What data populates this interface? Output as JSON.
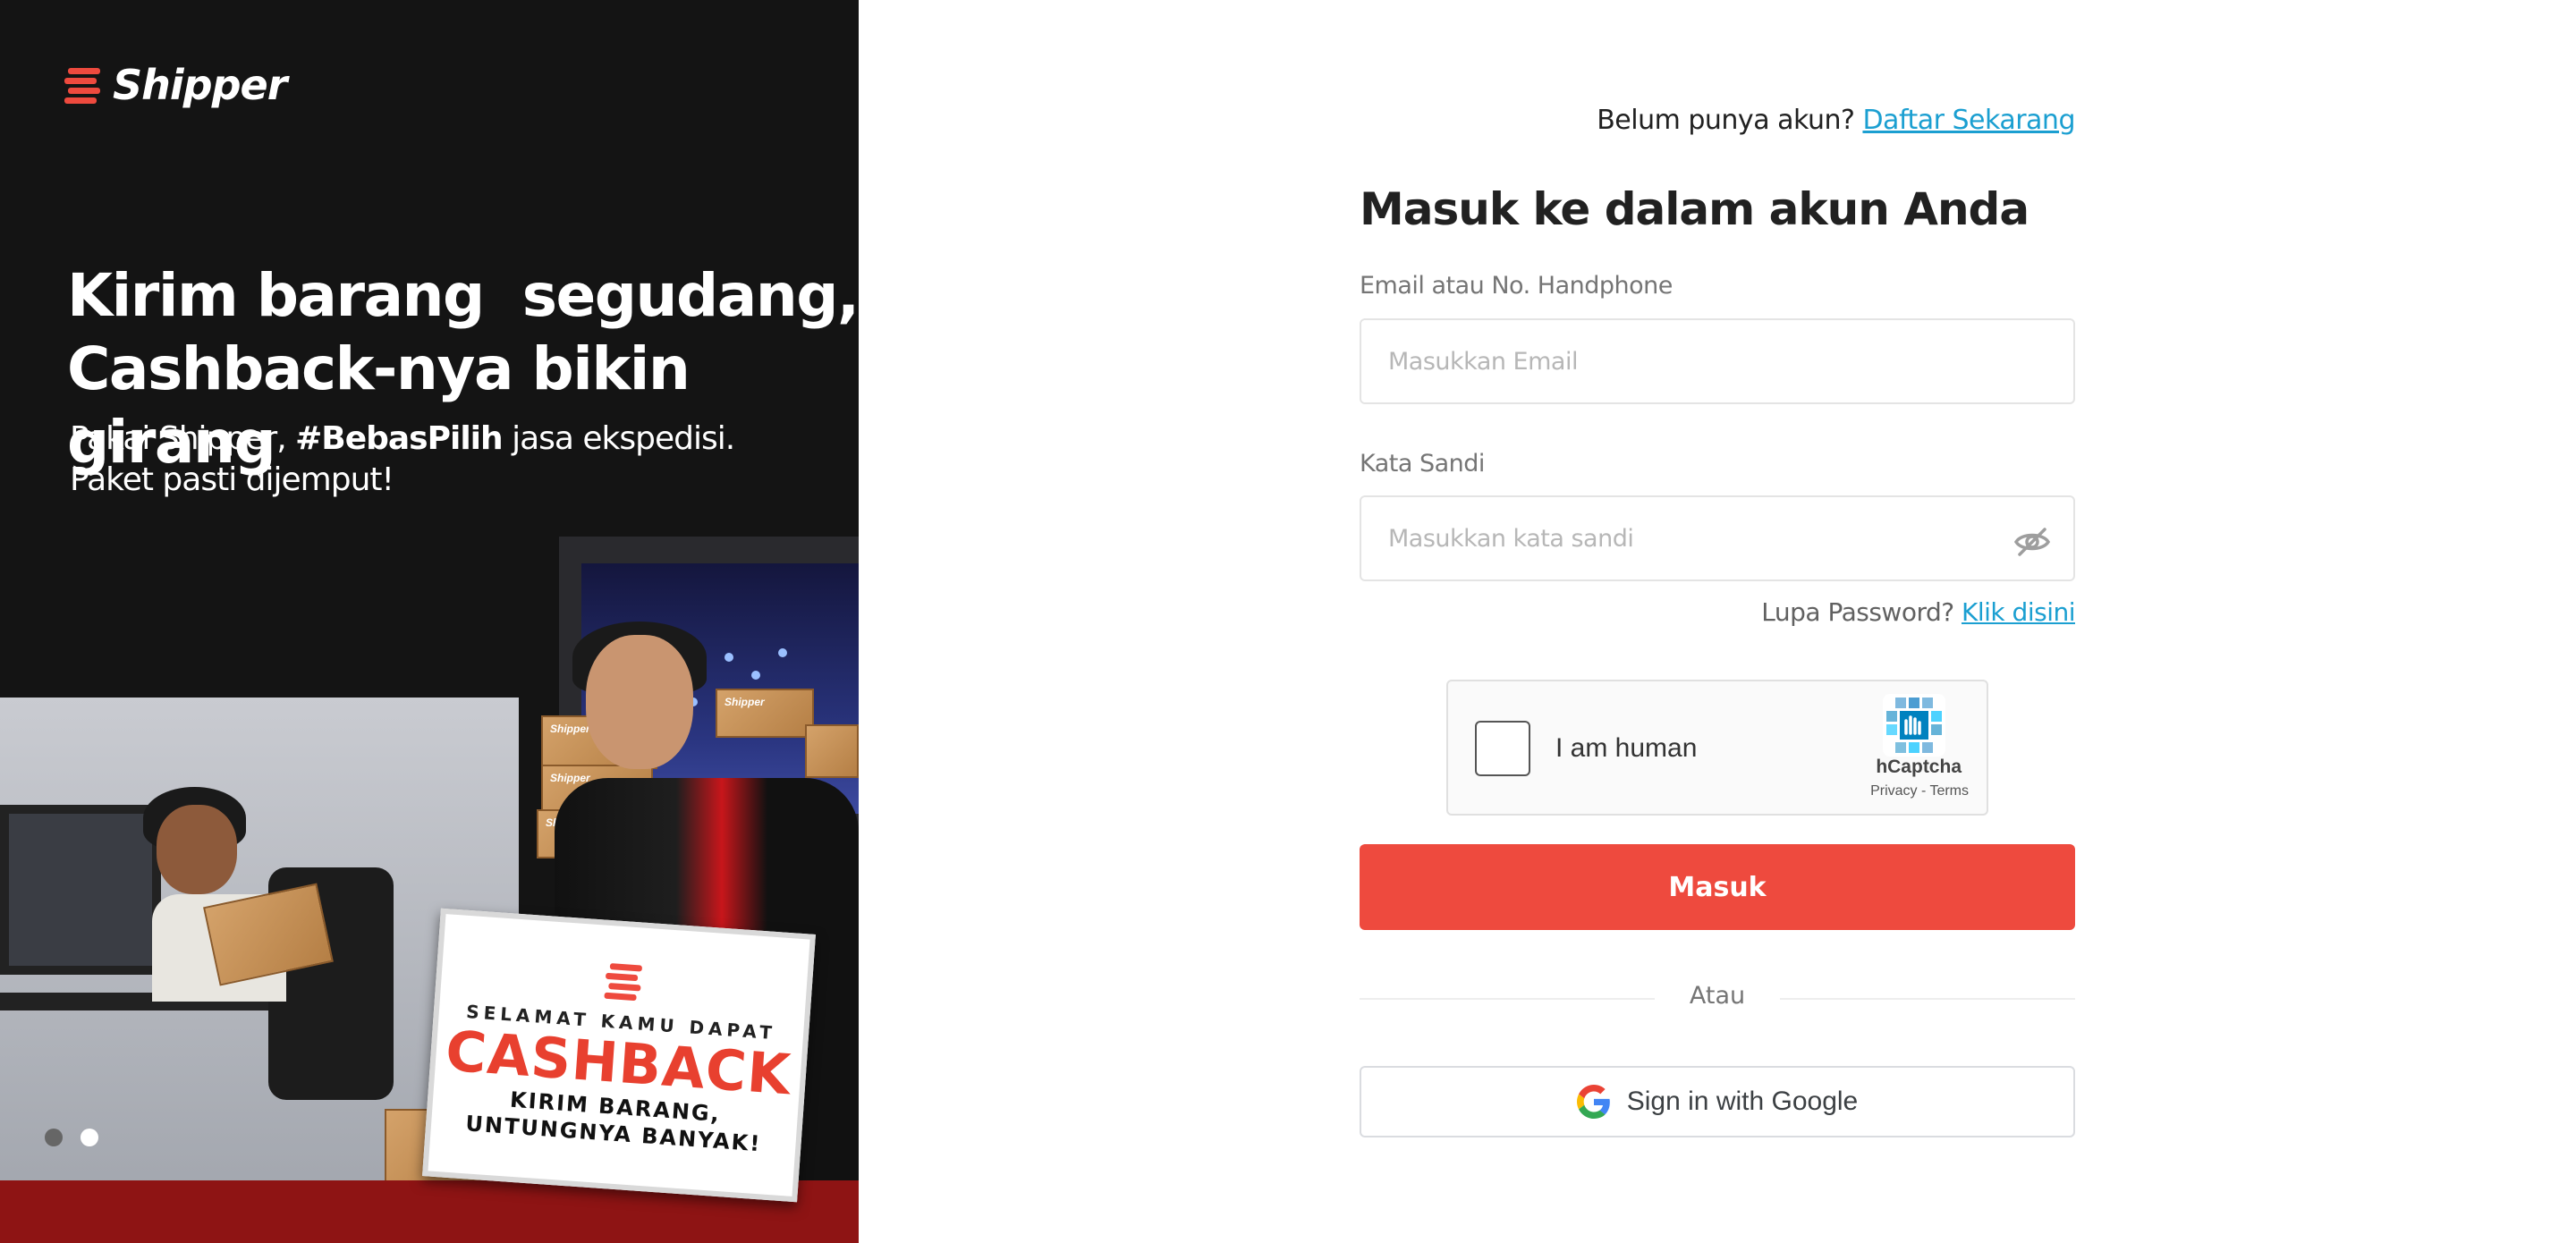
{
  "brand": {
    "name": "Shipper",
    "accent": "#ee4a3e",
    "link": "#1b9fd1"
  },
  "promo": {
    "headline_line1": "Kirim barang  segudang,",
    "headline_line2": "Cashback-nya bikin girang",
    "sub_prefix": "Pakai Shipper, ",
    "sub_bold": "#BebasPilih",
    "sub_suffix": " jasa ekspedisi.",
    "sub_line2": "Paket pasti dijemput!",
    "sign": {
      "line1": "SELAMAT KAMU DAPAT",
      "cashback": "CASHBACK",
      "line3a": "KIRIM BARANG,",
      "line3b": "UNTUNGNYA BANYAK!"
    },
    "box_label": "Shipper",
    "carousel": {
      "count": 2,
      "active_index": 1
    }
  },
  "login": {
    "register_prompt": "Belum punya akun?",
    "register_link": "Daftar Sekarang",
    "title": "Masuk ke dalam akun Anda",
    "email": {
      "label": "Email atau No. Handphone",
      "placeholder": "Masukkan Email",
      "value": ""
    },
    "password": {
      "label": "Kata Sandi",
      "placeholder": "Masukkan kata sandi",
      "value": "",
      "toggle_icon": "eye-slash-icon"
    },
    "forgot_prompt": "Lupa Password?",
    "forgot_link": "Klik disini",
    "captcha": {
      "label": "I am human",
      "brand": "hCaptcha",
      "links": "Privacy - Terms"
    },
    "submit_label": "Masuk",
    "divider_label": "Atau",
    "google_label": "Sign in with Google"
  }
}
